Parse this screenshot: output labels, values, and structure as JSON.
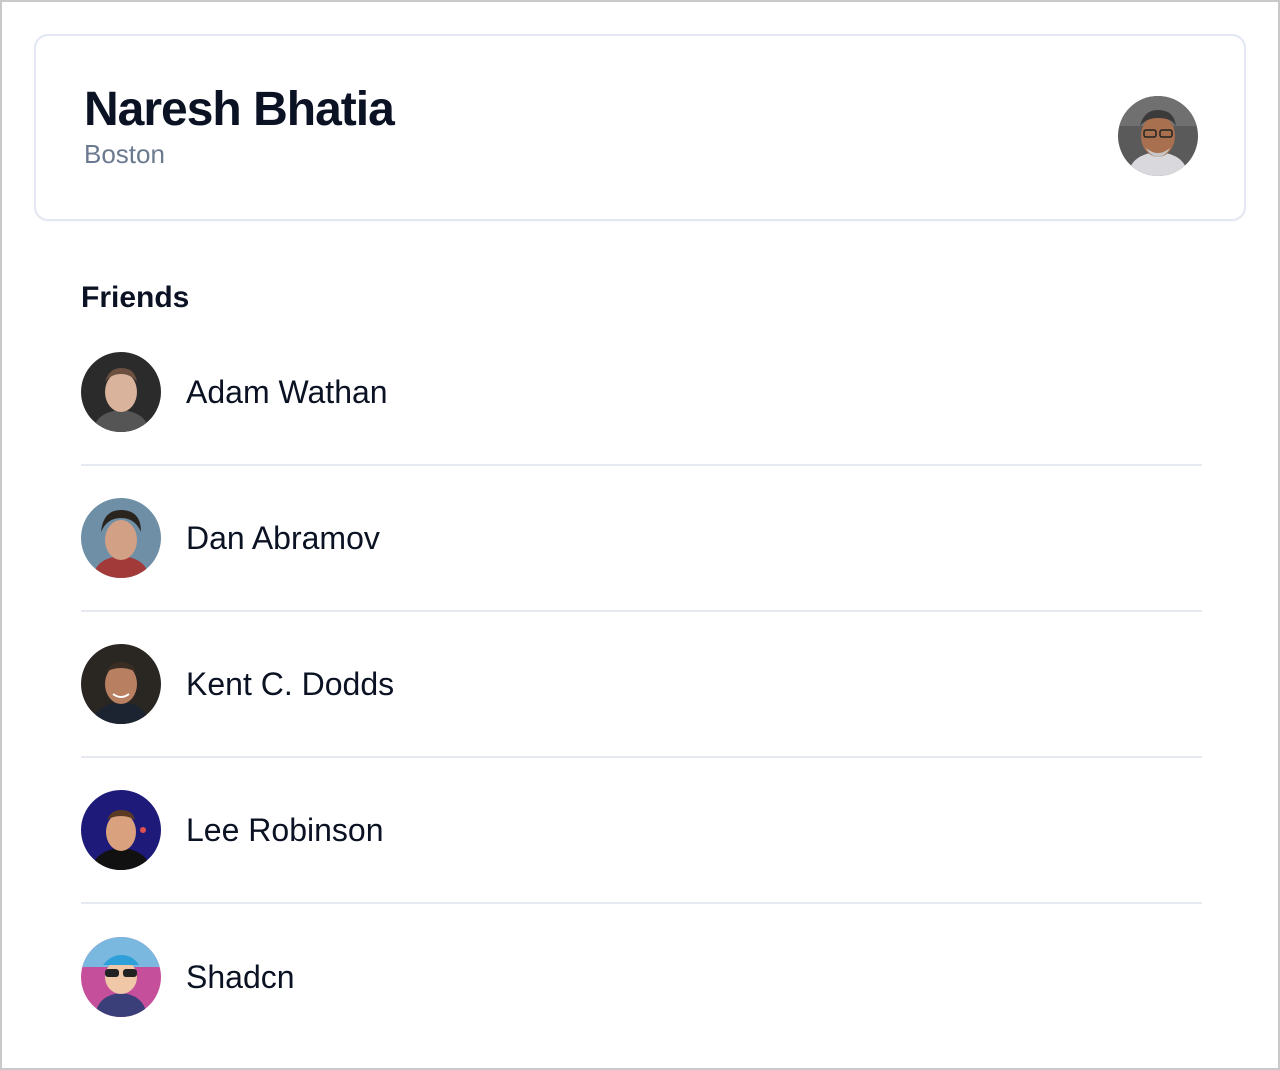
{
  "profile": {
    "name": "Naresh Bhatia",
    "city": "Boston",
    "avatar_icon": "user-photo-avatar"
  },
  "friends": {
    "title": "Friends",
    "items": [
      {
        "name": "Adam Wathan",
        "avatar_icon": "user-photo-avatar",
        "bg": "#2b2b2b"
      },
      {
        "name": "Dan Abramov",
        "avatar_icon": "user-photo-avatar",
        "bg": "#6e8fa6"
      },
      {
        "name": "Kent C. Dodds",
        "avatar_icon": "user-photo-avatar",
        "bg": "#2a2622"
      },
      {
        "name": "Lee Robinson",
        "avatar_icon": "user-photo-avatar",
        "bg": "#1d1a7a"
      },
      {
        "name": "Shadcn",
        "avatar_icon": "cartoon-avatar",
        "bg": "#c64f9c"
      }
    ]
  },
  "colors": {
    "text_primary": "#0b1224",
    "text_secondary": "#6b7a90",
    "border": "#e6e9f2"
  }
}
